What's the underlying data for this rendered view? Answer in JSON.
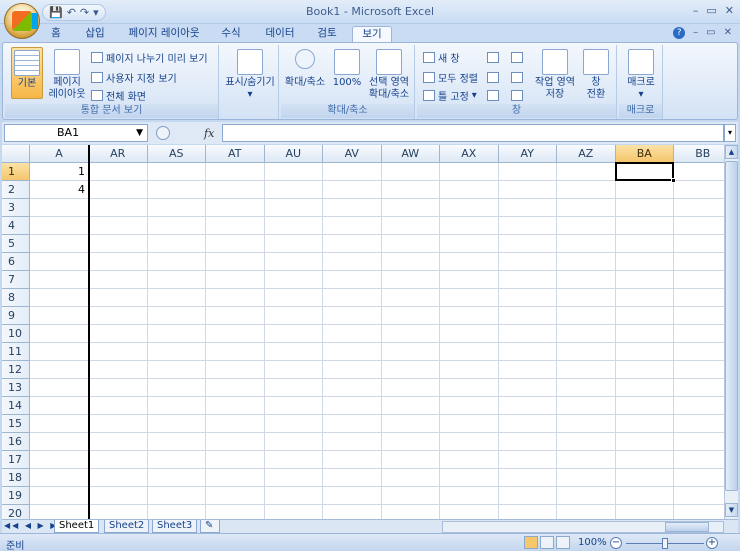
{
  "window": {
    "title": "Book1 - Microsoft Excel",
    "controls": [
      "–",
      "▭",
      "✕"
    ]
  },
  "qat": {
    "dropdown": "▾",
    "save": "💾",
    "undo": "↶",
    "redo": "↷"
  },
  "tabs": [
    {
      "label": "홈"
    },
    {
      "label": "삽입"
    },
    {
      "label": "페이지 레이아웃"
    },
    {
      "label": "수식"
    },
    {
      "label": "데이터"
    },
    {
      "label": "검토"
    },
    {
      "label": "보기",
      "active": true
    }
  ],
  "tab_right": {
    "help": "?",
    "minimize": "–",
    "restore": "▭",
    "close": "✕"
  },
  "ribbon": {
    "workbook_views": {
      "label": "통합 문서 보기",
      "normal": "기본",
      "page_layout": "페이지\n레이아웃",
      "page_break_preview": "페이지 나누기 미리 보기",
      "custom_views": "사용자 지정 보기",
      "full_screen": "전체 화면"
    },
    "show_hide": {
      "label": "표시/숨기기"
    },
    "zoom": {
      "label": "확대/축소",
      "zoom": "확대/축소",
      "hundred": "100%",
      "selection": "선택 영역\n확대/축소"
    },
    "window": {
      "label": "창",
      "new_window": "새 창",
      "arrange_all": "모두 정렬",
      "freeze_panes": "틀 고정",
      "save_workspace": "작업 영역\n저장",
      "switch_windows": "창\n전환"
    },
    "macros": {
      "label": "매크로",
      "macros": "매크로"
    }
  },
  "formula_bar": {
    "name_box": "BA1",
    "fx": "fx",
    "formula": ""
  },
  "sheet": {
    "columns": [
      "A",
      "AR",
      "AS",
      "AT",
      "AU",
      "AV",
      "AW",
      "AX",
      "AY",
      "AZ",
      "BA",
      "BB"
    ],
    "selected_column": "BA",
    "rows": [
      "1",
      "2",
      "3",
      "4",
      "5",
      "6",
      "7",
      "8",
      "9",
      "10",
      "11",
      "12",
      "13",
      "14",
      "15",
      "16",
      "17",
      "18",
      "19",
      "20"
    ],
    "selected_row": "1",
    "cells": {
      "A1": "1",
      "A2": "4"
    }
  },
  "sheet_tabs": [
    "Sheet1",
    "Sheet2",
    "Sheet3"
  ],
  "active_sheet": "Sheet1",
  "status": {
    "ready": "준비",
    "zoom": "100%"
  }
}
